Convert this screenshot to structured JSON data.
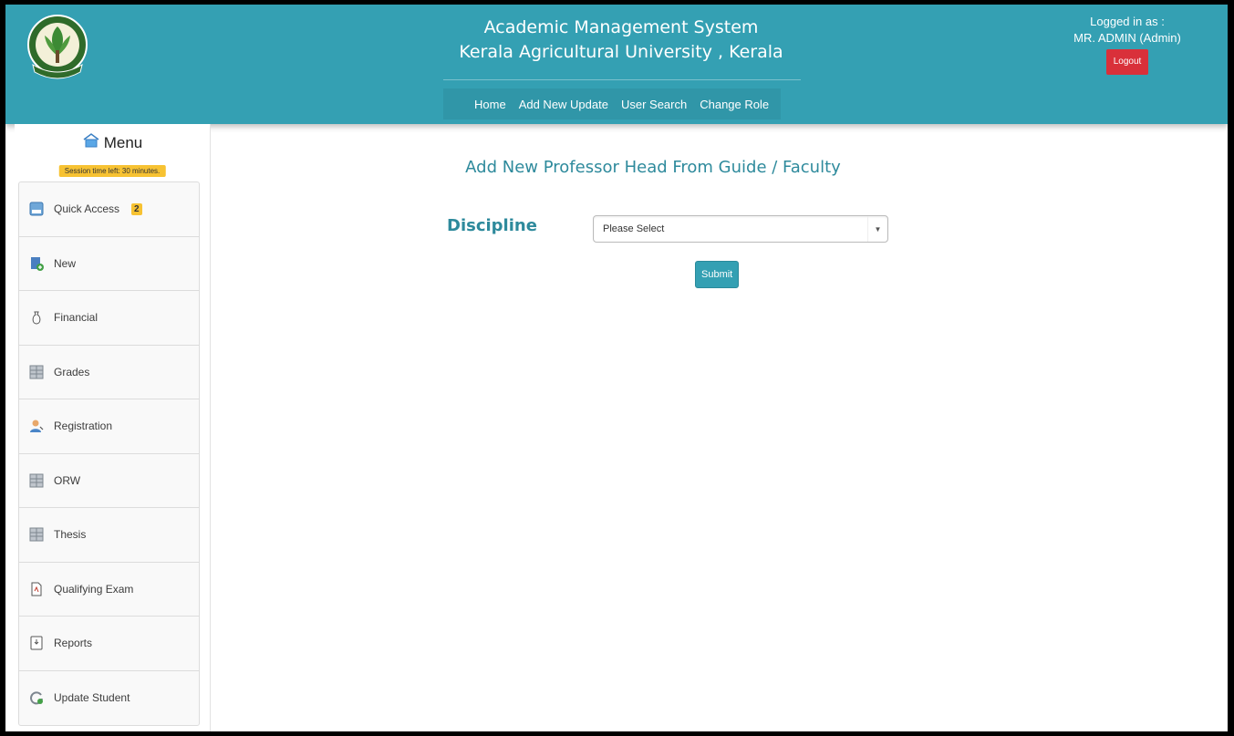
{
  "header": {
    "title_line1": "Academic Management System",
    "title_line2": "Kerala Agricultural University , Kerala",
    "nav": [
      "Home",
      "Add New Update",
      "User Search",
      "Change Role"
    ],
    "logged_in_label": "Logged in as :",
    "user_name": "MR. ADMIN (Admin)",
    "logout_label": "Logout"
  },
  "sidebar": {
    "menu_title": "Menu",
    "session_text": "Session time left: 30 minutes.",
    "items": [
      {
        "label": "Quick Access",
        "badge": "2",
        "icon": "quick-access-icon"
      },
      {
        "label": "New",
        "icon": "new-document-icon"
      },
      {
        "label": "Financial",
        "icon": "money-bag-icon"
      },
      {
        "label": "Grades",
        "icon": "grid-table-icon"
      },
      {
        "label": "Registration",
        "icon": "person-icon"
      },
      {
        "label": "ORW",
        "icon": "grid-table-icon"
      },
      {
        "label": "Thesis",
        "icon": "grid-table-icon"
      },
      {
        "label": "Qualifying Exam",
        "icon": "pdf-icon"
      },
      {
        "label": "Reports",
        "icon": "report-icon"
      },
      {
        "label": "Update Student",
        "icon": "refresh-icon"
      }
    ]
  },
  "main": {
    "page_title": "Add New Professor Head From Guide / Faculty",
    "discipline_label": "Discipline",
    "discipline_select": "Please Select",
    "submit_label": "Submit"
  },
  "colors": {
    "header_bg": "#34a0b3",
    "title_text": "#2e8a9c",
    "badge": "#f7c232",
    "logout": "#d9303a"
  }
}
